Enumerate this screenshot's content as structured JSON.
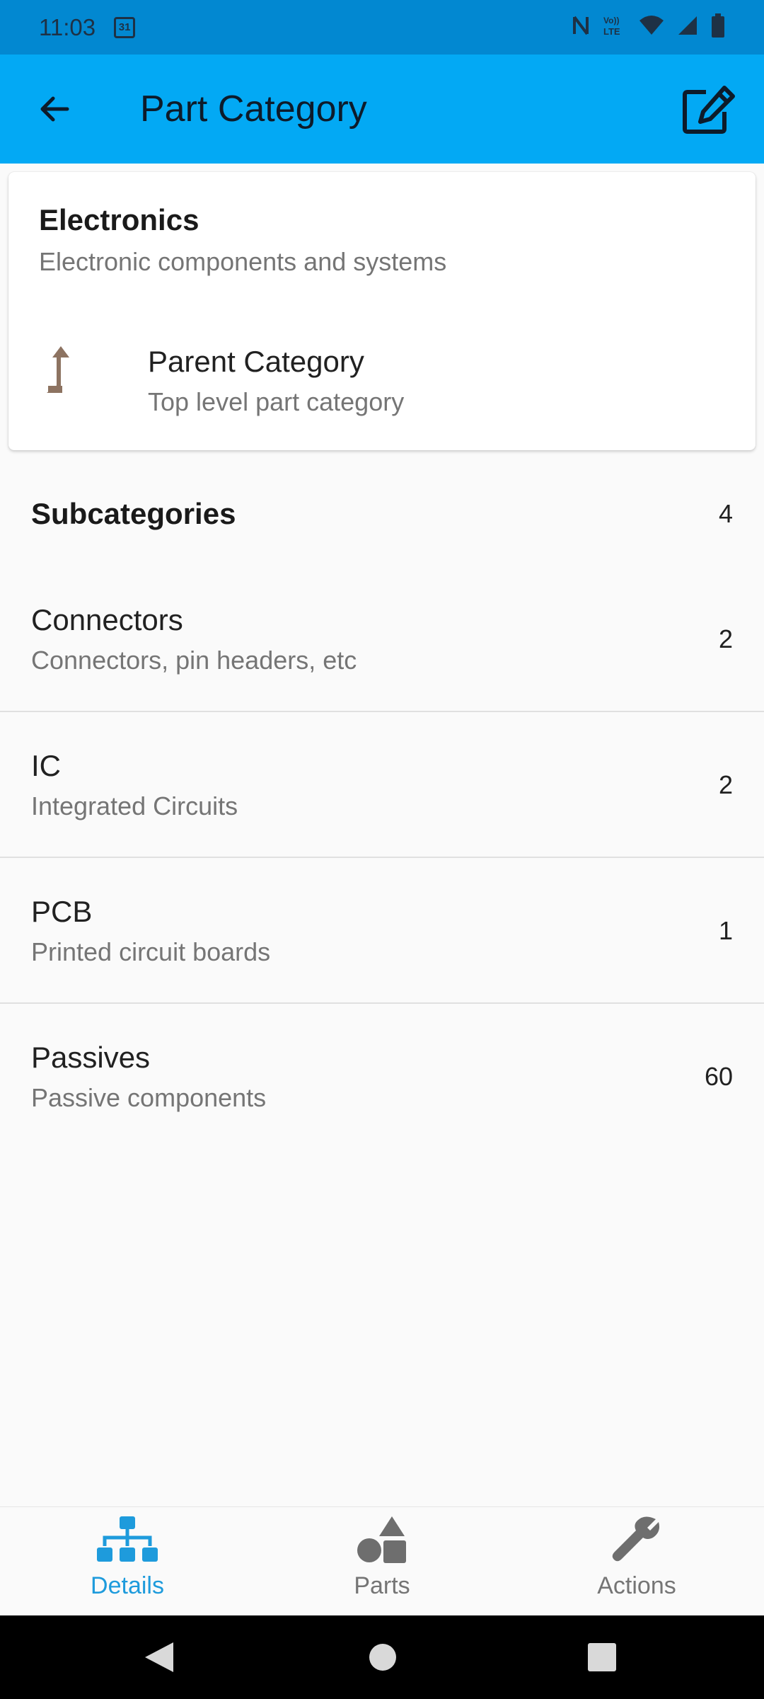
{
  "status_bar": {
    "time": "11:03",
    "calendar_day": "31",
    "icons": [
      "nfc-icon",
      "volte-icon",
      "wifi-icon",
      "signal-icon",
      "battery-icon"
    ],
    "volte_label": "Vo)) LTE"
  },
  "app_bar": {
    "title": "Part Category",
    "back_icon": "arrow-left-icon",
    "edit_icon": "edit-icon",
    "color": "#03a9f4"
  },
  "category": {
    "name": "Electronics",
    "description": "Electronic components and systems",
    "parent_title": "Parent Category",
    "parent_description": "Top level part category",
    "parent_icon": "level-up-icon"
  },
  "subcategories": {
    "header": "Subcategories",
    "count": "4",
    "items": [
      {
        "name": "Connectors",
        "description": "Connectors, pin headers, etc",
        "count": "2"
      },
      {
        "name": "IC",
        "description": "Integrated Circuits",
        "count": "2"
      },
      {
        "name": "PCB",
        "description": "Printed circuit boards",
        "count": "1"
      },
      {
        "name": "Passives",
        "description": "Passive components",
        "count": "60"
      }
    ]
  },
  "bottom_nav": {
    "items": [
      {
        "label": "Details",
        "icon": "sitemap-icon",
        "active": true
      },
      {
        "label": "Parts",
        "icon": "shapes-icon",
        "active": false
      },
      {
        "label": "Actions",
        "icon": "wrench-icon",
        "active": false
      }
    ],
    "active_color": "#1e9bdc"
  }
}
